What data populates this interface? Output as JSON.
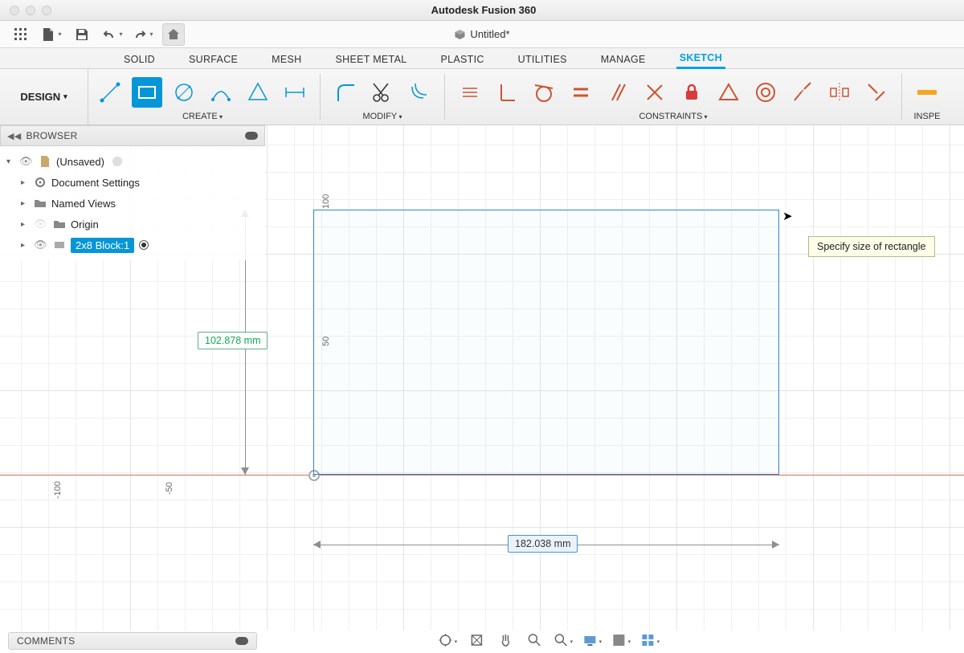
{
  "app_title": "Autodesk Fusion 360",
  "document_name": "Untitled*",
  "workspace_label": "DESIGN",
  "tabs": [
    "SOLID",
    "SURFACE",
    "MESH",
    "SHEET METAL",
    "PLASTIC",
    "UTILITIES",
    "MANAGE",
    "SKETCH"
  ],
  "active_tab": "SKETCH",
  "toolgroups": {
    "create": "CREATE",
    "modify": "MODIFY",
    "constraints": "CONSTRAINTS",
    "inspect_clipped": "INSPE"
  },
  "browser": {
    "title": "BROWSER",
    "root": "(Unsaved)",
    "items": [
      "Document Settings",
      "Named Views",
      "Origin",
      "2x8 Block:1"
    ]
  },
  "canvas": {
    "rulers": {
      "y_100": "100",
      "y_50": "50",
      "x_neg100": "-100",
      "x_neg50": "-50"
    },
    "dim_height": "102.878 mm",
    "dim_width": "182.038 mm",
    "tooltip": "Specify size of rectangle"
  },
  "comments_label": "COMMENTS"
}
